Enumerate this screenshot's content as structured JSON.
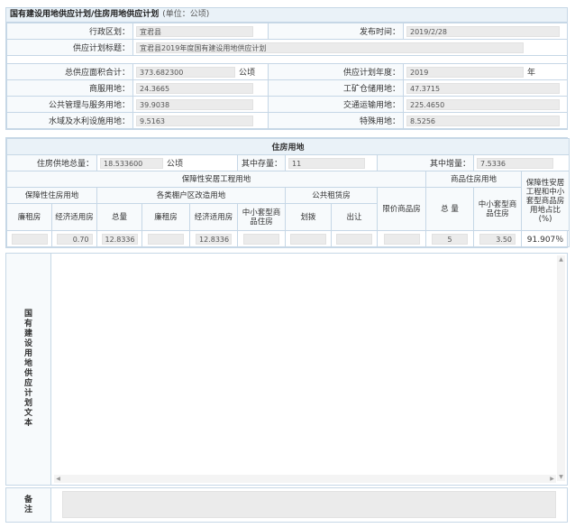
{
  "plan": {
    "title": "国有建设用地供应计划/住房用地供应计划",
    "unit": "(单位：公顷)",
    "region_label": "行政区划：",
    "region_value": "宜君县",
    "publish_time_label": "发布时间：",
    "publish_time_value": "2019/2/28",
    "plan_title_label": "供应计划标题：",
    "plan_title_value": "宜君县2019年度国有建设用地供应计划",
    "total_area_label": "总供应面积合计：",
    "total_area_value": "373.682300",
    "total_area_unit": "公顷",
    "plan_year_label": "供应计划年度：",
    "plan_year_value": "2019",
    "plan_year_unit": "年",
    "commercial_label": "商服用地：",
    "commercial_value": "24.3665",
    "industrial_label": "工矿仓储用地：",
    "industrial_value": "47.3715",
    "public_label": "公共管理与服务用地：",
    "public_value": "39.9038",
    "transport_label": "交通运输用地：",
    "transport_value": "225.4650",
    "water_label": "水域及水利设施用地：",
    "water_value": "9.5163",
    "special_label": "特殊用地：",
    "special_value": "8.5256"
  },
  "housing": {
    "section_title": "住房用地",
    "total_label": "住房供地总量：",
    "total_value": "18.533600",
    "total_unit": "公顷",
    "stock_label": "其中存量：",
    "stock_value": "11",
    "increment_label": "其中增量：",
    "increment_value": "7.5336",
    "affordable_project": "保障性安居工程用地",
    "commercial_housing": "商品住房用地",
    "ratio_header": "保障性安居工程和中小套型商品房用地占比(%)",
    "affordable_housing": "保障性住房用地",
    "shanty_reform": "各类棚户区改造用地",
    "public_rental": "公共租赁房",
    "limited_price": "限价商品房",
    "cols": {
      "low_rent": "廉租房",
      "economic": "经济适用房",
      "total": "总量",
      "low_rent2": "廉租房",
      "economic2": "经济适用房",
      "small_medium": "中小套型商品住房",
      "allocation": "划拨",
      "transfer": "出让",
      "ch_total": "总 量",
      "ch_small_medium": "中小套型商品住房"
    },
    "values": {
      "low_rent": "",
      "economic": "0.70",
      "total": "12.8336",
      "low_rent2": "",
      "economic2": "12.8336",
      "small_medium": "",
      "allocation": "",
      "transfer": "",
      "limited_price": "",
      "ch_total": "5",
      "ch_small_medium": "3.50",
      "ratio": "91.907％"
    }
  },
  "text_section": {
    "label": "国有建设用地供应计划文本"
  },
  "remark": {
    "label": "备注"
  }
}
